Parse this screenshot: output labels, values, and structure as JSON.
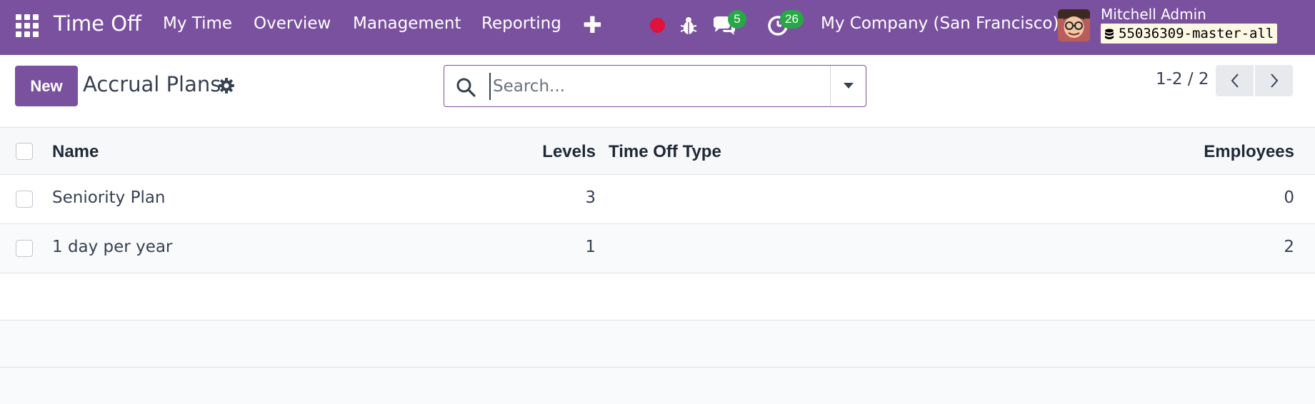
{
  "navbar": {
    "app_title": "Time Off",
    "menu": [
      "My Time",
      "Overview",
      "Management",
      "Reporting"
    ],
    "plus_label": "✚",
    "messages_count": "5",
    "activities_count": "26",
    "company": "My Company (San Francisco)",
    "user_name": "Mitchell Admin",
    "database": "55036309-master-all",
    "colors": {
      "navbar": "#7a519f",
      "badge": "#28a745",
      "record": "#e0113b"
    }
  },
  "control_panel": {
    "new_label": "New",
    "title": "Accrual Plans",
    "search_placeholder": "Search...",
    "pager": "1-2 / 2"
  },
  "table": {
    "columns": [
      "Name",
      "Levels",
      "Time Off Type",
      "Employees"
    ],
    "rows": [
      {
        "name": "Seniority Plan",
        "levels": "3",
        "time_off_type": "",
        "employees": "0"
      },
      {
        "name": "1 day per year",
        "levels": "1",
        "time_off_type": "",
        "employees": "2"
      }
    ]
  }
}
